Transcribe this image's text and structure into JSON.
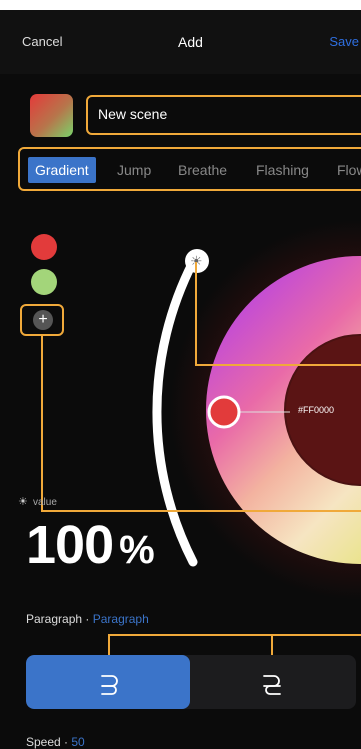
{
  "nav": {
    "cancel": "Cancel",
    "title": "Add",
    "save": "Save"
  },
  "scene": {
    "name": "New scene"
  },
  "tabs": [
    {
      "label": "Gradient",
      "active": true
    },
    {
      "label": "Jump",
      "active": false
    },
    {
      "label": "Breathe",
      "active": false
    },
    {
      "label": "Flashing",
      "active": false
    },
    {
      "label": "Flow",
      "active": false
    }
  ],
  "colors": {
    "dot_red": "#e23b3b",
    "dot_green": "#a3d57a",
    "accent": "#3b74c9",
    "annotation": "#f0a93a"
  },
  "add_label": "+",
  "brightness": {
    "label": "value",
    "value": "100",
    "unit": "%"
  },
  "picker": {
    "hex": "#FF0000"
  },
  "paragraph": {
    "label": "Paragraph",
    "sep": " · ",
    "value": "Paragraph"
  },
  "speed": {
    "label": "Speed",
    "sep": " · ",
    "value": "50"
  }
}
